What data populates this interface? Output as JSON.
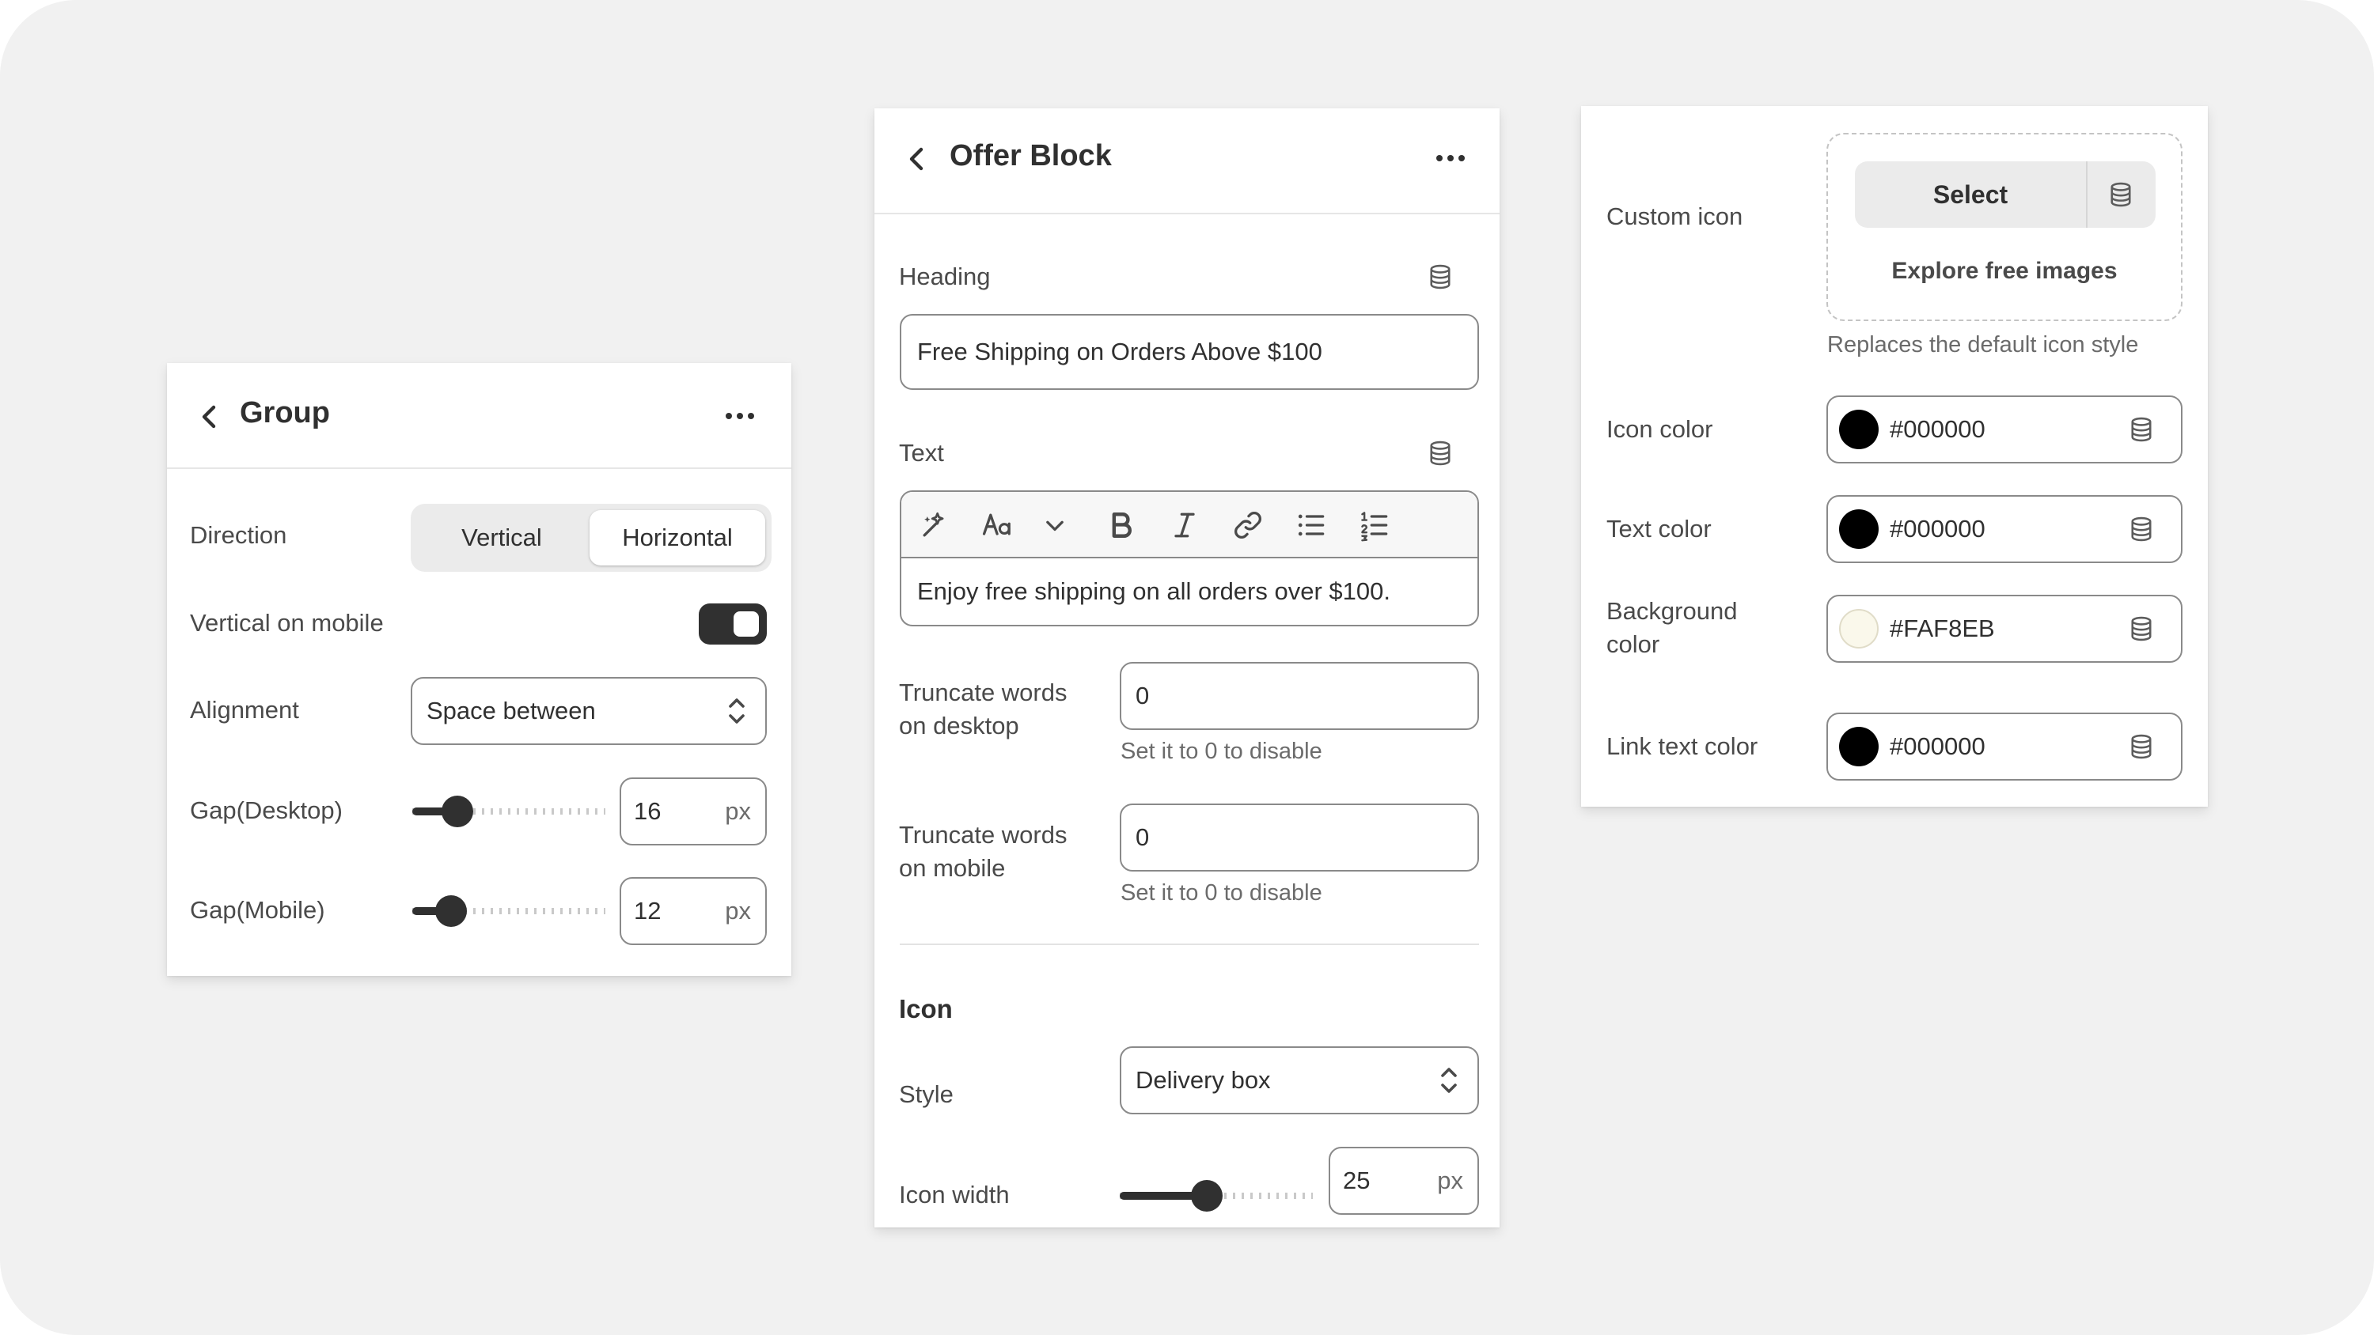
{
  "group_panel": {
    "title": "Group",
    "direction": {
      "label": "Direction",
      "options": [
        "Vertical",
        "Horizontal"
      ],
      "selected": "Horizontal"
    },
    "vertical_on_mobile": {
      "label": "Vertical on mobile",
      "enabled": true
    },
    "alignment": {
      "label": "Alignment",
      "value": "Space between"
    },
    "gap_desktop": {
      "label": "Gap(Desktop)",
      "value": "16",
      "unit": "px",
      "slider_level": 0.18
    },
    "gap_mobile": {
      "label": "Gap(Mobile)",
      "value": "12",
      "unit": "px",
      "slider_level": 0.14
    }
  },
  "offer_panel": {
    "title": "Offer Block",
    "heading": {
      "label": "Heading",
      "value": "Free Shipping on Orders Above $100"
    },
    "text": {
      "label": "Text",
      "toolbar": [
        "magic-icon",
        "font-size-icon",
        "chevron-down-icon",
        "bold-icon",
        "italic-icon",
        "link-icon",
        "bullet-list-icon",
        "numbered-list-icon"
      ],
      "value": "Enjoy free shipping on all orders over $100."
    },
    "truncate_desktop": {
      "label_line1": "Truncate words",
      "label_line2": "on desktop",
      "value": "0",
      "help": "Set it to 0 to disable"
    },
    "truncate_mobile": {
      "label_line1": "Truncate words",
      "label_line2": "on mobile",
      "value": "0",
      "help": "Set it to 0 to disable"
    },
    "icon_section": {
      "heading": "Icon"
    },
    "style": {
      "label": "Style",
      "value": "Delivery box"
    },
    "icon_width": {
      "label": "Icon width",
      "value": "25",
      "unit": "px",
      "slider_level": 0.44
    }
  },
  "icon_panel": {
    "custom_icon": {
      "label": "Custom icon",
      "select_label": "Select",
      "explore_label": "Explore free images",
      "help": "Replaces the default icon style"
    },
    "icon_color": {
      "label": "Icon color",
      "value": "#000000",
      "color": "#000000"
    },
    "text_color": {
      "label": "Text color",
      "value": "#000000",
      "color": "#000000"
    },
    "background_color": {
      "label_line1": "Background",
      "label_line2": "color",
      "value": "#FAF8EB",
      "color": "#FAF8EB"
    },
    "link_text_color": {
      "label": "Link text color",
      "value": "#000000",
      "color": "#000000"
    }
  }
}
